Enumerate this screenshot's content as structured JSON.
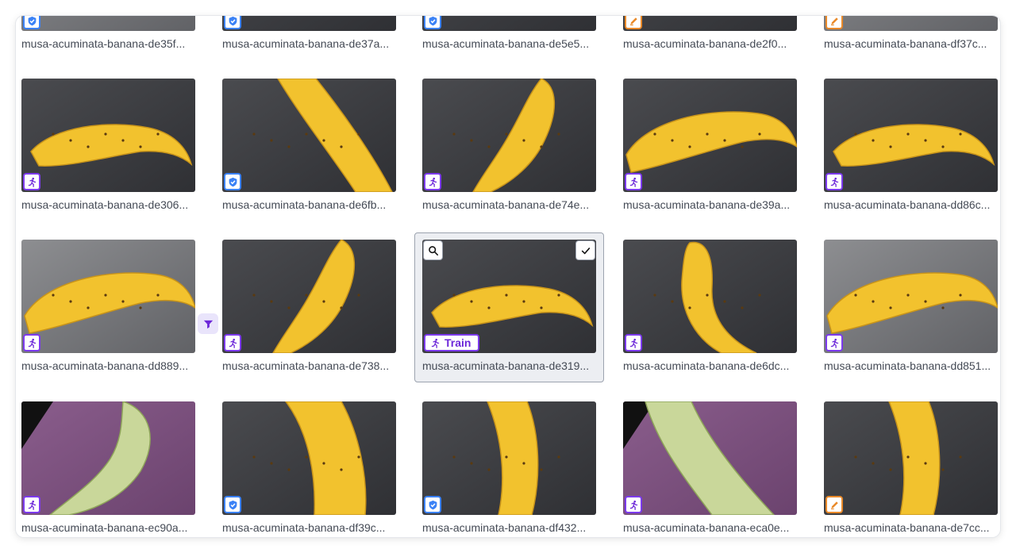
{
  "colors": {
    "train": "#7c3aed",
    "validation": "#3b82f6",
    "test": "#ea8a2a",
    "selection_bg": "#eceef2"
  },
  "rows": [
    [
      {
        "name": "musa-acuminata-banana-de35f...",
        "split": "validation",
        "bg": "light",
        "banana": "none"
      },
      {
        "name": "musa-acuminata-banana-de37a...",
        "split": "validation",
        "bg": "dark",
        "banana": "none"
      },
      {
        "name": "musa-acuminata-banana-de5e5...",
        "split": "validation",
        "bg": "dark",
        "banana": "tip"
      },
      {
        "name": "musa-acuminata-banana-de2f0...",
        "split": "test",
        "bg": "dark",
        "banana": "none"
      },
      {
        "name": "musa-acuminata-banana-df37c...",
        "split": "test",
        "bg": "light",
        "banana": "tip"
      }
    ],
    [
      {
        "name": "musa-acuminata-banana-de306...",
        "split": "train",
        "bg": "dark",
        "banana": "horizontal"
      },
      {
        "name": "musa-acuminata-banana-de6fb...",
        "split": "validation",
        "bg": "dark",
        "banana": "diagonal"
      },
      {
        "name": "musa-acuminata-banana-de74e...",
        "split": "train",
        "bg": "dark",
        "banana": "diagonal-up"
      },
      {
        "name": "musa-acuminata-banana-de39a...",
        "split": "train",
        "bg": "dark",
        "banana": "horizontal-wide"
      },
      {
        "name": "musa-acuminata-banana-dd86c...",
        "split": "train",
        "bg": "dark",
        "banana": "horizontal"
      }
    ],
    [
      {
        "name": "musa-acuminata-banana-dd889...",
        "split": "train",
        "bg": "light",
        "banana": "horizontal-wide"
      },
      {
        "name": "musa-acuminata-banana-de738...",
        "split": "train",
        "bg": "dark",
        "banana": "diagonal-up"
      },
      {
        "name": "musa-acuminata-banana-de319...",
        "split": "train",
        "bg": "dark",
        "banana": "horizontal",
        "selected": true,
        "label": "Train"
      },
      {
        "name": "musa-acuminata-banana-de6dc...",
        "split": "train",
        "bg": "dark",
        "banana": "vertical-speckled"
      },
      {
        "name": "musa-acuminata-banana-dd851...",
        "split": "train",
        "bg": "light",
        "banana": "horizontal-wide"
      }
    ],
    [
      {
        "name": "musa-acuminata-banana-ec90a...",
        "split": "train",
        "bg": "purple",
        "banana": "green-curve"
      },
      {
        "name": "musa-acuminata-banana-df39c...",
        "split": "validation",
        "bg": "dark",
        "banana": "vertical-wide"
      },
      {
        "name": "musa-acuminata-banana-df432...",
        "split": "validation",
        "bg": "dark",
        "banana": "vertical"
      },
      {
        "name": "musa-acuminata-banana-eca0e...",
        "split": "train",
        "bg": "purple",
        "banana": "green-diagonal"
      },
      {
        "name": "musa-acuminata-banana-de7cc...",
        "split": "test",
        "bg": "dark",
        "banana": "vertical"
      }
    ]
  ],
  "icons": {
    "train": "running-person-icon",
    "validation": "shield-check-icon",
    "test": "pencil-icon",
    "zoom": "magnifier-icon",
    "check": "checkmark-icon",
    "side": "funnel-icon"
  }
}
